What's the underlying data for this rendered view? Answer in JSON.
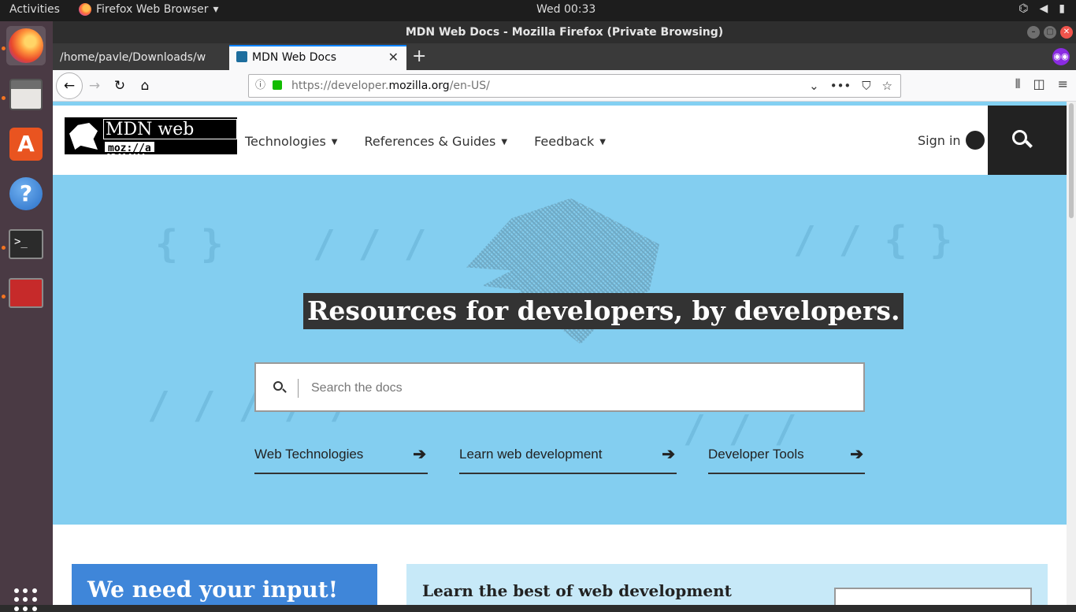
{
  "system": {
    "activities": "Activities",
    "app_menu": "Firefox Web Browser",
    "clock": "Wed 00:33"
  },
  "window": {
    "title": "MDN Web Docs - Mozilla Firefox (Private Browsing)"
  },
  "tabs": [
    {
      "label": "/home/pavle/Downloads/w"
    },
    {
      "label": "MDN Web Docs"
    }
  ],
  "url": {
    "prefix": "https://developer.",
    "host": "mozilla.org",
    "path": "/en-US/"
  },
  "mdn": {
    "logo_text": "MDN web docs",
    "logo_sub": "moz://a",
    "nav": [
      {
        "label": "Technologies"
      },
      {
        "label": "References & Guides"
      },
      {
        "label": "Feedback"
      }
    ],
    "signin": "Sign in",
    "hero_title": "Resources for developers, by developers.",
    "search_placeholder": "Search the docs",
    "hero_links": [
      {
        "label": "Web Technologies"
      },
      {
        "label": "Learn web development"
      },
      {
        "label": "Developer Tools"
      }
    ],
    "card_input": "We need your input!",
    "card_learn": "Learn the best of web development"
  },
  "icons": {
    "caret": "▾",
    "arrow": "➔"
  },
  "colors": {
    "hero_bg": "#83cef0",
    "accent_blue": "#3f86d9",
    "header_dark": "#222222"
  }
}
